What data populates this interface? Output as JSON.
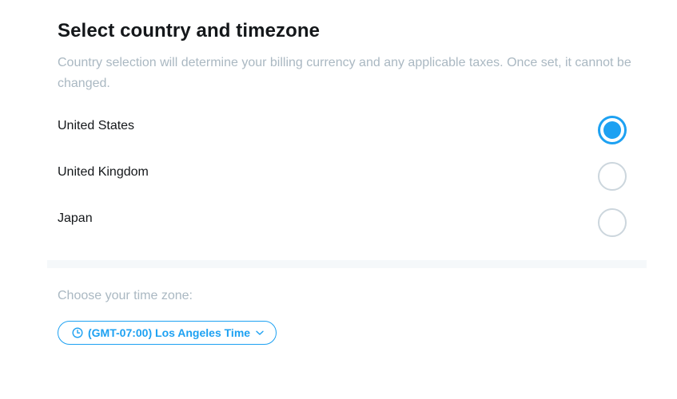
{
  "header": {
    "title": "Select country and timezone",
    "description": "Country selection will determine your billing currency and any applicable taxes. Once set, it cannot be changed."
  },
  "countries": {
    "options": [
      {
        "label": "United States",
        "selected": true
      },
      {
        "label": "United Kingdom",
        "selected": false
      },
      {
        "label": "Japan",
        "selected": false
      }
    ]
  },
  "timezone": {
    "label": "Choose your time zone:",
    "value": "(GMT-07:00) Los Angeles Time",
    "icon": "clock-icon",
    "dropdown_icon": "chevron-down-icon"
  },
  "colors": {
    "accent": "#1da1f2",
    "title_text": "#14171a",
    "muted_text": "#aab8c2",
    "radio_border": "#ccd6dd",
    "divider": "#f5f8fa"
  }
}
